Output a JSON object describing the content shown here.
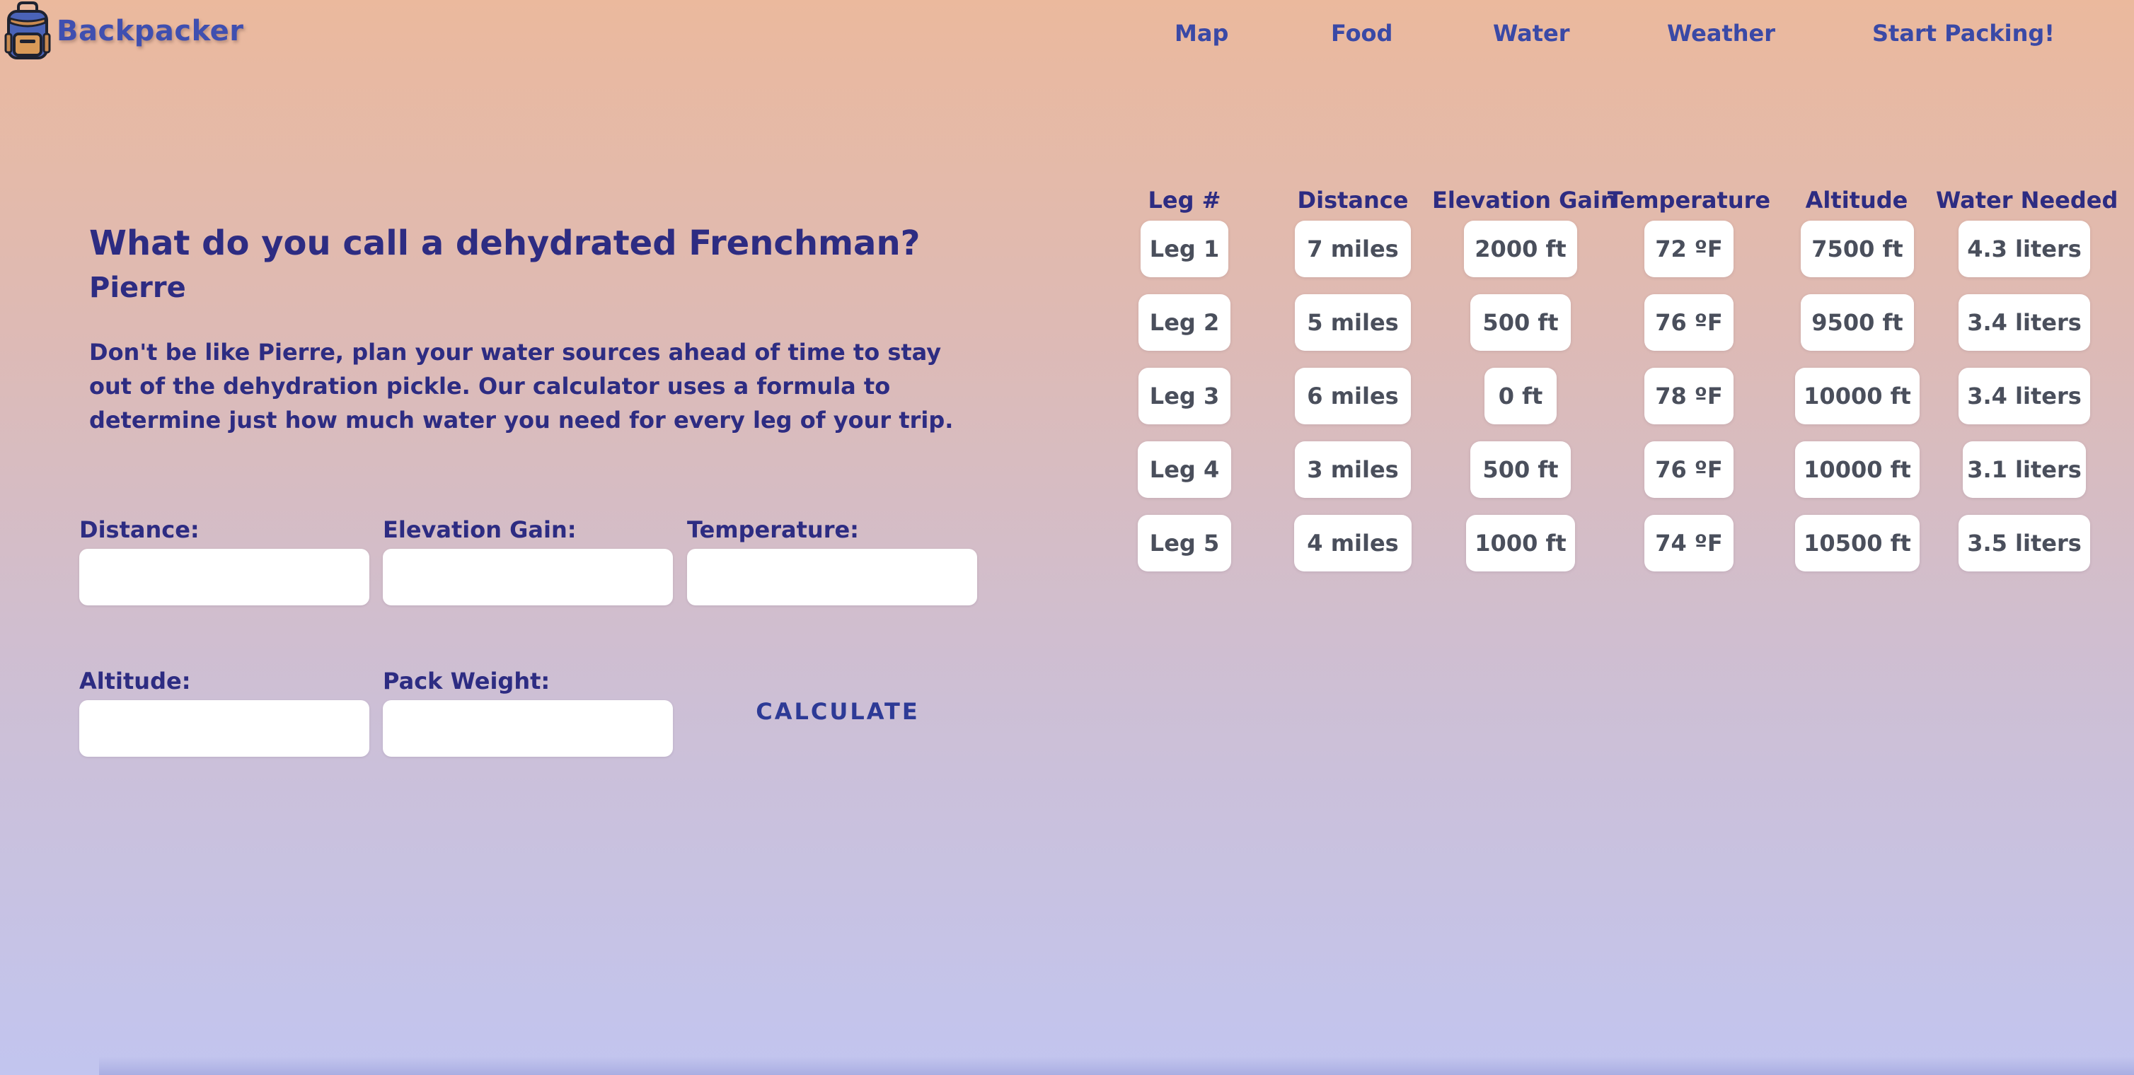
{
  "brand": {
    "name": "Backpacker",
    "icon": "backpack-icon"
  },
  "nav": {
    "items": [
      {
        "label": "Map"
      },
      {
        "label": "Food"
      },
      {
        "label": "Water"
      },
      {
        "label": "Weather"
      },
      {
        "label": "Start Packing!"
      }
    ]
  },
  "intro": {
    "joke_title": "What do you call a dehydrated Frenchman?",
    "joke_answer": "Pierre",
    "description": "Don't be like Pierre, plan your water sources ahead of time to stay out of the dehydration pickle. Our calculator uses a formula to determine just how much water you need for every leg of your trip."
  },
  "form": {
    "distance": {
      "label": "Distance:",
      "value": "",
      "placeholder": ""
    },
    "elevation_gain": {
      "label": "Elevation Gain:",
      "value": "",
      "placeholder": ""
    },
    "temperature": {
      "label": "Temperature:",
      "value": "",
      "placeholder": ""
    },
    "altitude": {
      "label": "Altitude:",
      "value": "",
      "placeholder": ""
    },
    "pack_weight": {
      "label": "Pack Weight:",
      "value": "",
      "placeholder": ""
    },
    "calculate_label": "CALCULATE"
  },
  "table": {
    "headers": [
      "Leg #",
      "Distance",
      "Elevation Gain",
      "Temperature",
      "Altitude",
      "Water Needed"
    ],
    "rows": [
      [
        "Leg 1",
        "7 miles",
        "2000 ft",
        "72 ºF",
        "7500 ft",
        "4.3 liters"
      ],
      [
        "Leg 2",
        "5 miles",
        "500 ft",
        "76 ºF",
        "9500 ft",
        "3.4 liters"
      ],
      [
        "Leg 3",
        "6 miles",
        "0 ft",
        "78 ºF",
        "10000 ft",
        "3.4 liters"
      ],
      [
        "Leg 4",
        "3 miles",
        "500 ft",
        "76 ºF",
        "10000 ft",
        "3.1 liters"
      ],
      [
        "Leg 5",
        "4 miles",
        "1000 ft",
        "74 ºF",
        "10500 ft",
        "3.5 liters"
      ]
    ]
  },
  "colors": {
    "text_primary": "#2D2C82",
    "brand": "#3F4FB0",
    "nav": "#3A49A6",
    "cell_text": "#4A4F5C",
    "cell_bg": "#FFFFFF"
  }
}
